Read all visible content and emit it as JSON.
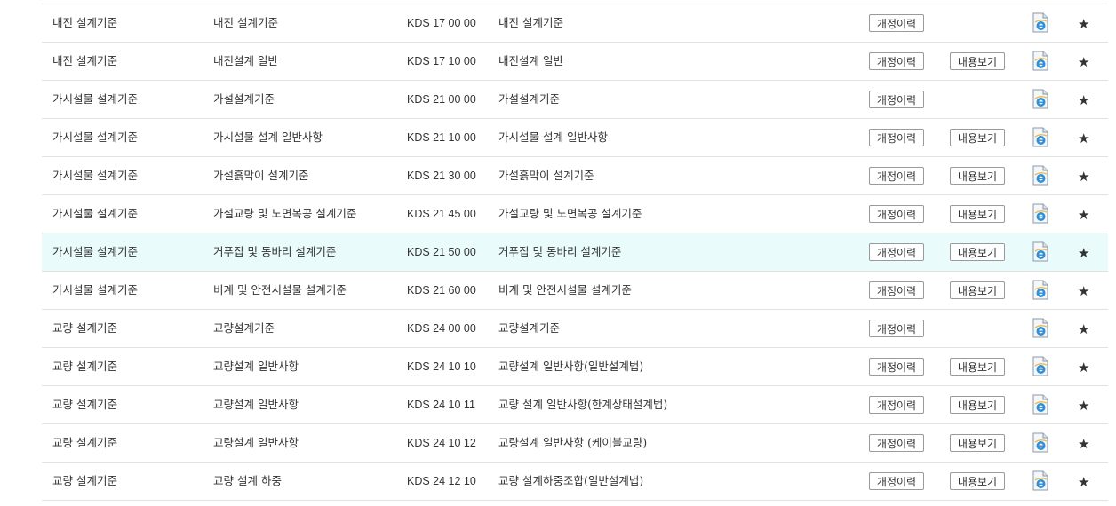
{
  "buttons": {
    "history_label": "개정이력",
    "view_label": "내용보기"
  },
  "icons": {
    "document": "document-ie-icon",
    "favorite": "star-icon",
    "star_glyph": "★"
  },
  "rows": [
    {
      "category": "내진 설계기준",
      "subtitle": "내진 설계기준",
      "code": "KDS 17 00 00",
      "title": "내진 설계기준",
      "has_view": false,
      "highlight": false
    },
    {
      "category": "내진 설계기준",
      "subtitle": "내진설계 일반",
      "code": "KDS 17 10 00",
      "title": "내진설계 일반",
      "has_view": true,
      "highlight": false
    },
    {
      "category": "가시설물 설계기준",
      "subtitle": "가설설계기준",
      "code": "KDS 21 00 00",
      "title": "가설설계기준",
      "has_view": false,
      "highlight": false
    },
    {
      "category": "가시설물 설계기준",
      "subtitle": "가시설물 설계 일반사항",
      "code": "KDS 21 10 00",
      "title": "가시설물 설계 일반사항",
      "has_view": true,
      "highlight": false
    },
    {
      "category": "가시설물 설계기준",
      "subtitle": "가설흙막이 설계기준",
      "code": "KDS 21 30 00",
      "title": "가설흙막이 설계기준",
      "has_view": true,
      "highlight": false
    },
    {
      "category": "가시설물 설계기준",
      "subtitle": "가설교량 및 노면복공 설계기준",
      "code": "KDS 21 45 00",
      "title": "가설교량 및 노면복공 설계기준",
      "has_view": true,
      "highlight": false
    },
    {
      "category": "가시설물 설계기준",
      "subtitle": "거푸집 및 동바리 설계기준",
      "code": "KDS 21 50 00",
      "title": "거푸집 및 동바리 설계기준",
      "has_view": true,
      "highlight": true
    },
    {
      "category": "가시설물 설계기준",
      "subtitle": "비계 및 안전시설물 설계기준",
      "code": "KDS 21 60 00",
      "title": "비계 및 안전시설물 설계기준",
      "has_view": true,
      "highlight": false
    },
    {
      "category": "교량 설계기준",
      "subtitle": "교량설계기준",
      "code": "KDS 24 00 00",
      "title": "교량설계기준",
      "has_view": false,
      "highlight": false
    },
    {
      "category": "교량 설계기준",
      "subtitle": "교량설계 일반사항",
      "code": "KDS 24 10 10",
      "title": "교량설계 일반사항(일반설계법)",
      "has_view": true,
      "highlight": false
    },
    {
      "category": "교량 설계기준",
      "subtitle": "교량설계 일반사항",
      "code": "KDS 24 10 11",
      "title": "교량 설계 일반사항(한계상태설계법)",
      "has_view": true,
      "highlight": false
    },
    {
      "category": "교량 설계기준",
      "subtitle": "교량설계 일반사항",
      "code": "KDS 24 10 12",
      "title": "교량설계 일반사항 (케이블교량)",
      "has_view": true,
      "highlight": false
    },
    {
      "category": "교량 설계기준",
      "subtitle": "교량 설계 하중",
      "code": "KDS 24 12 10",
      "title": "교량 설계하중조합(일반설계법)",
      "has_view": true,
      "highlight": false
    }
  ]
}
